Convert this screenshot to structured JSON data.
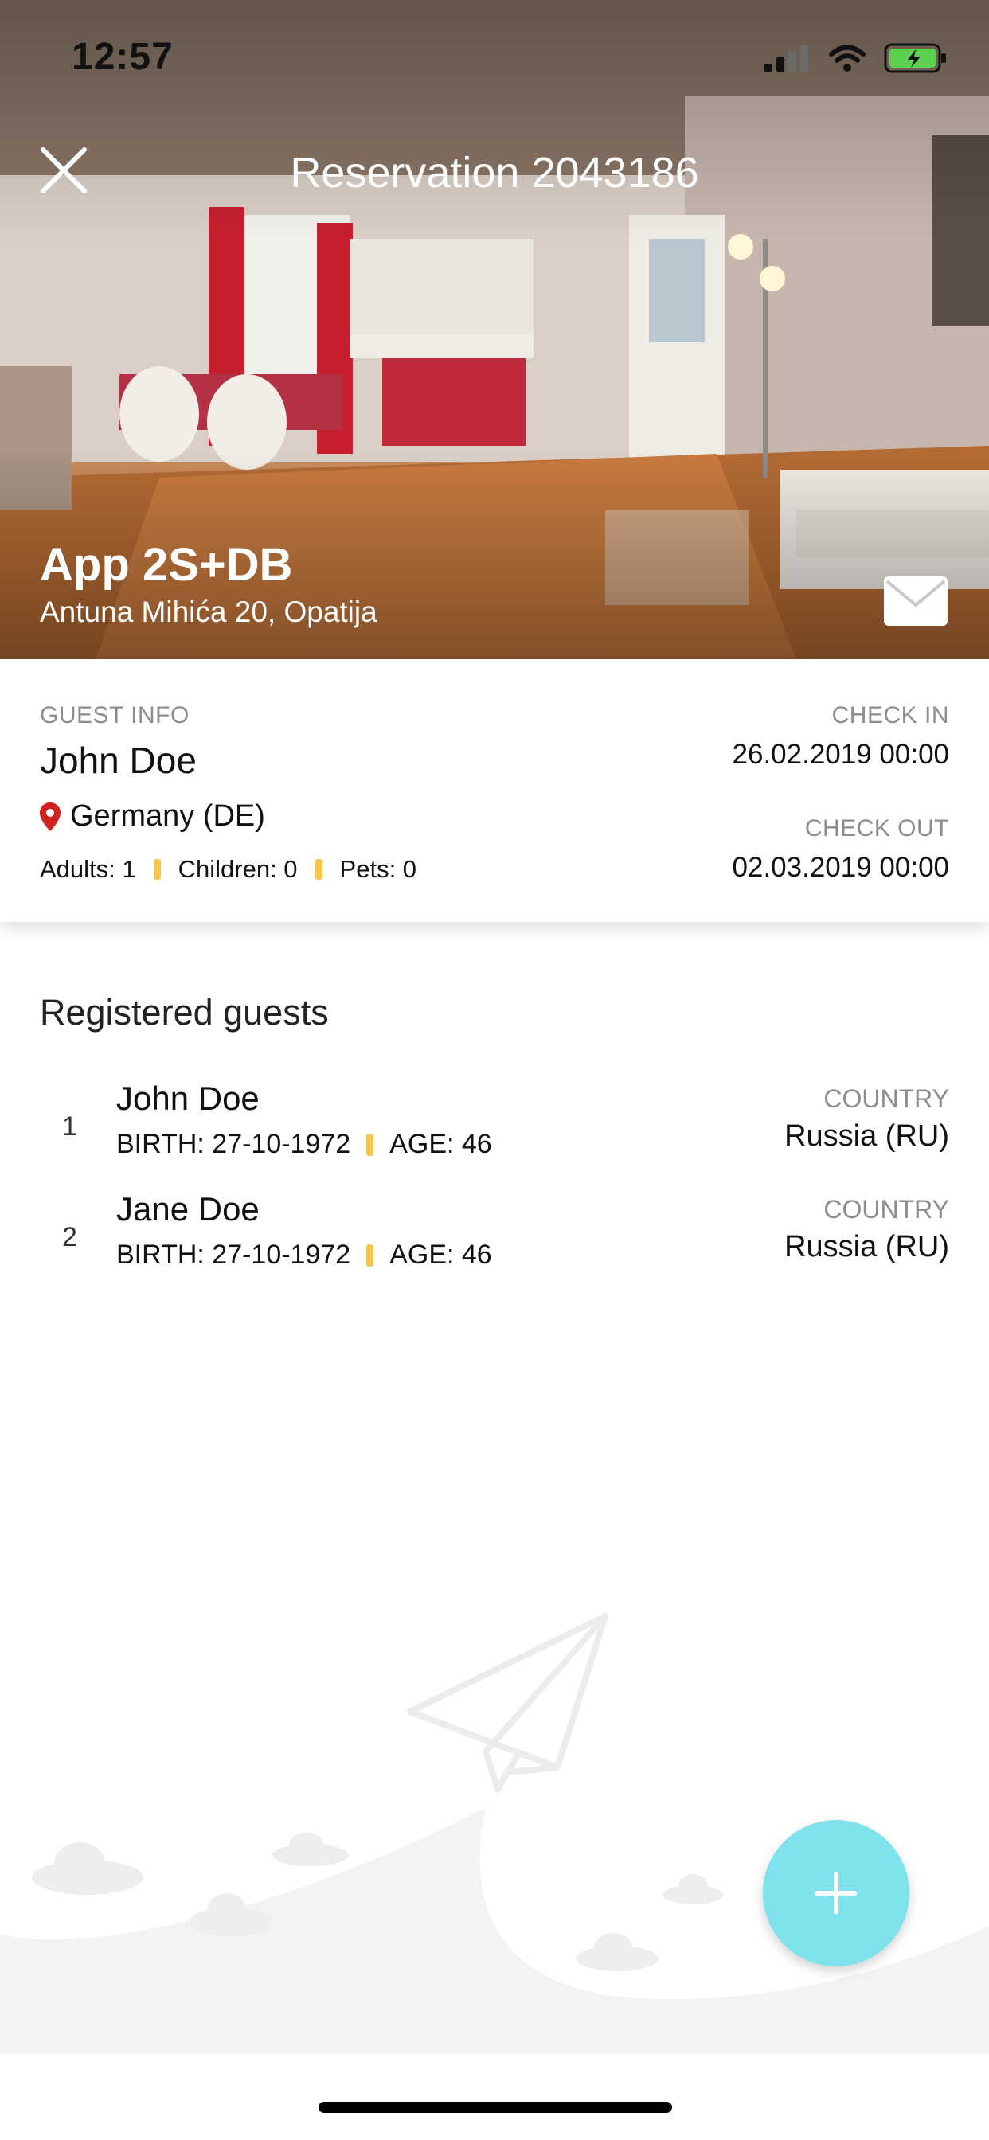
{
  "status_bar": {
    "time": "12:57"
  },
  "header": {
    "title": "Reservation 2043186"
  },
  "apartment": {
    "name": "App 2S+DB",
    "address": "Antuna Mihića 20, Opatija"
  },
  "guest_info": {
    "label": "GUEST INFO",
    "name": "John Doe",
    "country": "Germany (DE)",
    "adults": "Adults: 1",
    "children": "Children: 0",
    "pets": "Pets: 0",
    "check_in_label": "CHECK IN",
    "check_in": "26.02.2019 00:00",
    "check_out_label": "CHECK OUT",
    "check_out": "02.03.2019 00:00"
  },
  "registered": {
    "title": "Registered guests",
    "guests": [
      {
        "index": "1",
        "name": "John Doe",
        "birth": "BIRTH: 27-10-1972",
        "age": "AGE: 46",
        "country_label": "COUNTRY",
        "country": "Russia (RU)"
      },
      {
        "index": "2",
        "name": "Jane Doe",
        "birth": "BIRTH: 27-10-1972",
        "age": "AGE: 46",
        "country_label": "COUNTRY",
        "country": "Russia (RU)"
      }
    ]
  },
  "colors": {
    "accent_fab": "#7fe1ec",
    "separator": "#f4c64c",
    "pin": "#d0221f",
    "muted_label": "#8d8d8d"
  },
  "icons": [
    "close-icon",
    "mail-icon",
    "location-pin-icon",
    "plus-icon",
    "paper-plane-icon",
    "signal-icon",
    "wifi-icon",
    "battery-icon"
  ]
}
